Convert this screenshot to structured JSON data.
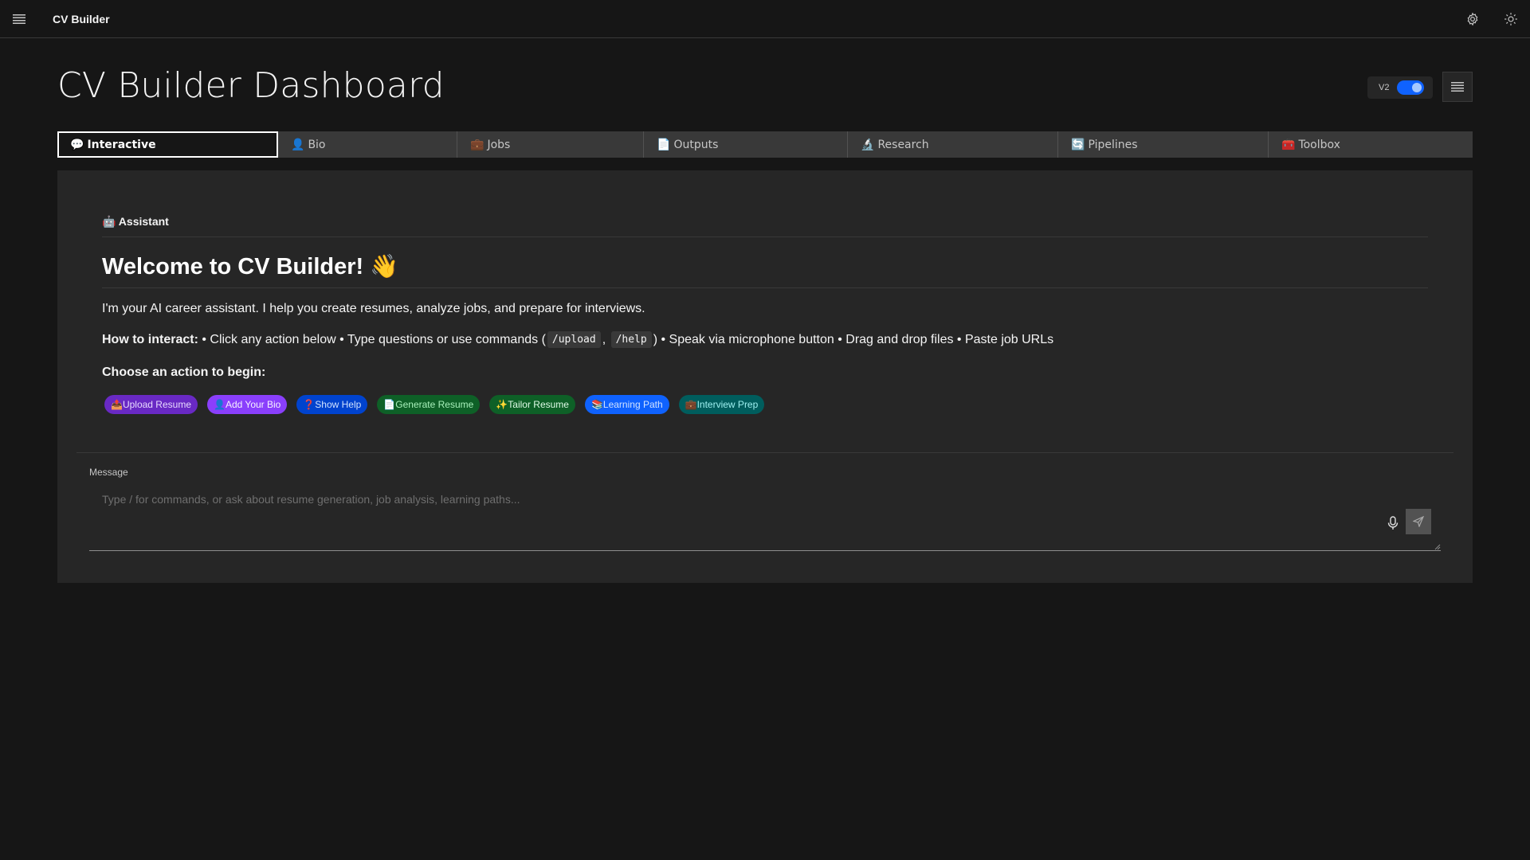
{
  "header": {
    "app_name": "CV Builder"
  },
  "main": {
    "title": "CV Builder Dashboard",
    "version_label": "V2",
    "tabs": [
      {
        "icon": "💬",
        "label": "Interactive"
      },
      {
        "icon": "👤",
        "label": "Bio"
      },
      {
        "icon": "💼",
        "label": "Jobs"
      },
      {
        "icon": "📄",
        "label": "Outputs"
      },
      {
        "icon": "🔬",
        "label": "Research"
      },
      {
        "icon": "🔄",
        "label": "Pipelines"
      },
      {
        "icon": "🧰",
        "label": "Toolbox"
      }
    ]
  },
  "assistant": {
    "heading": "🤖 Assistant",
    "welcome": "Welcome to CV Builder! 👋",
    "intro": "I'm your AI career assistant. I help you create resumes, analyze jobs, and prepare for interviews.",
    "howto_label": "How to interact:",
    "howto_text1": " • Click any action below • Type questions or use commands (",
    "code1": "/upload",
    "comma": ", ",
    "code2": "/help",
    "howto_text2": ") • Speak via microphone button • Drag and drop files • Paste job URLs",
    "choose": "Choose an action to begin:",
    "actions": [
      "📤Upload Resume",
      "👤Add Your Bio",
      "❓Show Help",
      "📄Generate Resume",
      "✨Tailor Resume",
      "📚Learning Path",
      "💼Interview Prep"
    ]
  },
  "message": {
    "label": "Message",
    "placeholder": "Type / for commands, or ask about resume generation, job analysis, learning paths..."
  },
  "colors": {
    "background": "#161616",
    "panel": "#262626",
    "accent": "#0f62fe"
  }
}
